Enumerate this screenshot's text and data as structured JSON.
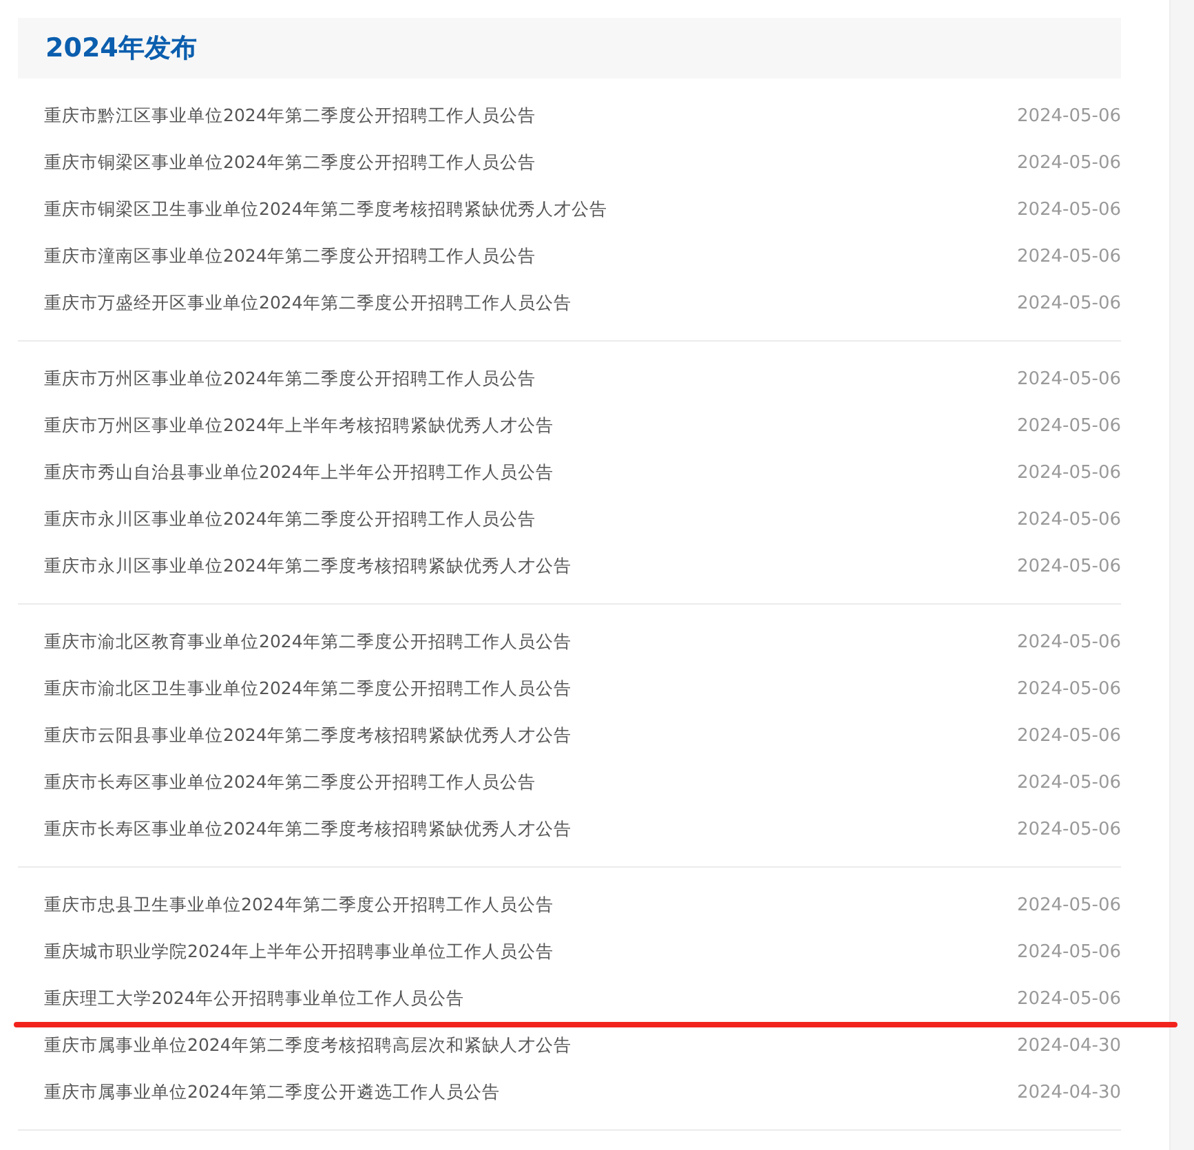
{
  "section": {
    "title": "2024年发布"
  },
  "groups": [
    {
      "items": [
        {
          "title": "重庆市黔江区事业单位2024年第二季度公开招聘工作人员公告",
          "date": "2024-05-06",
          "underlined": false
        },
        {
          "title": "重庆市铜梁区事业单位2024年第二季度公开招聘工作人员公告",
          "date": "2024-05-06",
          "underlined": false
        },
        {
          "title": "重庆市铜梁区卫生事业单位2024年第二季度考核招聘紧缺优秀人才公告",
          "date": "2024-05-06",
          "underlined": false
        },
        {
          "title": "重庆市潼南区事业单位2024年第二季度公开招聘工作人员公告",
          "date": "2024-05-06",
          "underlined": false
        },
        {
          "title": "重庆市万盛经开区事业单位2024年第二季度公开招聘工作人员公告",
          "date": "2024-05-06",
          "underlined": false
        }
      ]
    },
    {
      "items": [
        {
          "title": "重庆市万州区事业单位2024年第二季度公开招聘工作人员公告",
          "date": "2024-05-06",
          "underlined": false
        },
        {
          "title": "重庆市万州区事业单位2024年上半年考核招聘紧缺优秀人才公告",
          "date": "2024-05-06",
          "underlined": false
        },
        {
          "title": "重庆市秀山自治县事业单位2024年上半年公开招聘工作人员公告",
          "date": "2024-05-06",
          "underlined": false
        },
        {
          "title": "重庆市永川区事业单位2024年第二季度公开招聘工作人员公告",
          "date": "2024-05-06",
          "underlined": false
        },
        {
          "title": "重庆市永川区事业单位2024年第二季度考核招聘紧缺优秀人才公告",
          "date": "2024-05-06",
          "underlined": false
        }
      ]
    },
    {
      "items": [
        {
          "title": "重庆市渝北区教育事业单位2024年第二季度公开招聘工作人员公告",
          "date": "2024-05-06",
          "underlined": false
        },
        {
          "title": "重庆市渝北区卫生事业单位2024年第二季度公开招聘工作人员公告",
          "date": "2024-05-06",
          "underlined": false
        },
        {
          "title": "重庆市云阳县事业单位2024年第二季度考核招聘紧缺优秀人才公告",
          "date": "2024-05-06",
          "underlined": false
        },
        {
          "title": "重庆市长寿区事业单位2024年第二季度公开招聘工作人员公告",
          "date": "2024-05-06",
          "underlined": false
        },
        {
          "title": "重庆市长寿区事业单位2024年第二季度考核招聘紧缺优秀人才公告",
          "date": "2024-05-06",
          "underlined": false
        }
      ]
    },
    {
      "items": [
        {
          "title": "重庆市忠县卫生事业单位2024年第二季度公开招聘工作人员公告",
          "date": "2024-05-06",
          "underlined": false
        },
        {
          "title": "重庆城市职业学院2024年上半年公开招聘事业单位工作人员公告",
          "date": "2024-05-06",
          "underlined": false
        },
        {
          "title": "重庆理工大学2024年公开招聘事业单位工作人员公告",
          "date": "2024-05-06",
          "underlined": true
        },
        {
          "title": "重庆市属事业单位2024年第二季度考核招聘高层次和紧缺人才公告",
          "date": "2024-04-30",
          "underlined": false
        },
        {
          "title": "重庆市属事业单位2024年第二季度公开遴选工作人员公告",
          "date": "2024-04-30",
          "underlined": false
        }
      ]
    }
  ]
}
